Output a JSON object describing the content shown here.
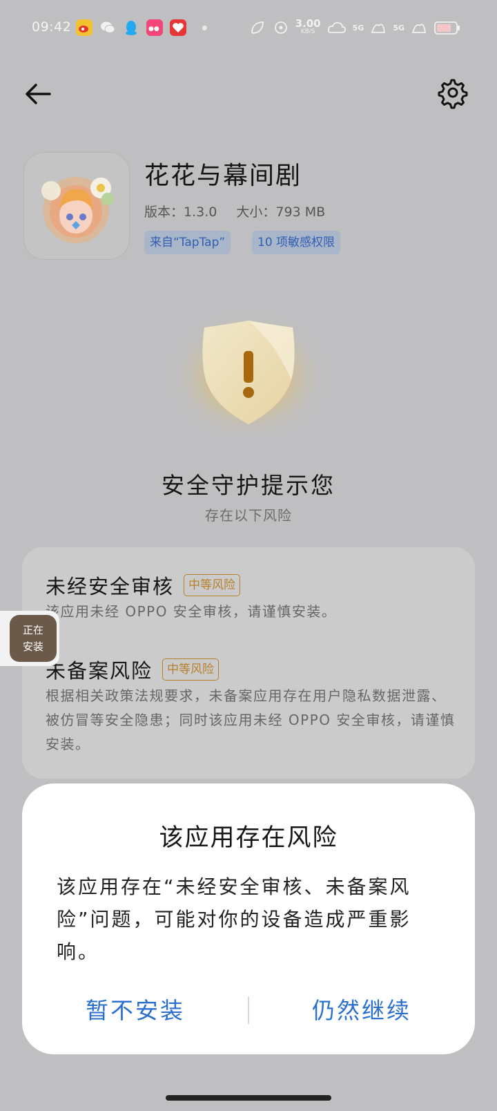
{
  "status_bar": {
    "time": "09:42",
    "notification_icons": [
      "weibo-icon",
      "wechat-icon",
      "qq-icon",
      "lofter-icon",
      "red-app-icon"
    ],
    "net_speed_value": "3.00",
    "net_speed_unit": "KB/S",
    "signal1_label": "5G",
    "signal2_label": "5G"
  },
  "header": {
    "back_icon": "arrow-left-icon",
    "settings_icon": "gear-icon"
  },
  "app": {
    "name": "花花与幕间剧",
    "version_label": "版本：",
    "version": "1.3.0",
    "size_label": "大小：",
    "size": "793 MB",
    "tags": [
      "来自“TapTap”",
      "10 项敏感权限"
    ]
  },
  "shield": {
    "title": "安全守护提示您",
    "subtitle": "存在以下风险"
  },
  "risks": [
    {
      "title": "未经安全审核",
      "badge": "中等风险",
      "description": "该应用未经 OPPO 安全审核，请谨慎安装。"
    },
    {
      "title": "未备案风险",
      "badge": "中等风险",
      "description": "根据相关政策法规要求，未备案应用存在用户隐私数据泄露、被仿冒等安全隐患；同时该应用未经 OPPO 安全审核，请谨慎安装。"
    }
  ],
  "floating_bubble": {
    "line1": "正在",
    "line2": "安装"
  },
  "dialog": {
    "title": "该应用存在风险",
    "message": "该应用存在“未经安全审核、未备案风险”问题，可能对你的设备造成严重影响。",
    "cancel_label": "暂不安装",
    "continue_label": "仍然继续"
  },
  "colors": {
    "accent_blue": "#2a6fd0",
    "risk_badge": "#b7802a",
    "backdrop": "#bfbfc1"
  }
}
